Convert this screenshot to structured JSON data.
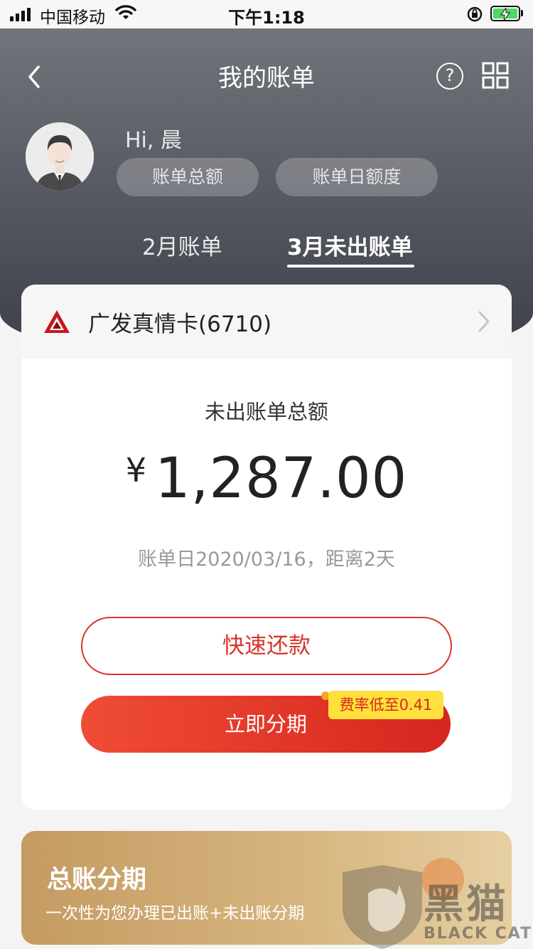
{
  "status_bar": {
    "carrier": "中国移动",
    "time": "下午1:18"
  },
  "nav": {
    "title": "我的账单",
    "help_glyph": "?"
  },
  "user": {
    "greeting": "Hi, 晨",
    "pills": [
      "账单总额",
      "账单日额度"
    ]
  },
  "tabs": [
    {
      "label": "2月账单",
      "active": false
    },
    {
      "label": "3月未出账单",
      "active": true
    }
  ],
  "card": {
    "name": "广发真情卡(6710)",
    "unbilled_label": "未出账单总额",
    "currency": "¥",
    "amount": "1,287.00",
    "bill_date_text": "账单日2020/03/16，距离2天",
    "repay_button": "快速还款",
    "installment_button": "立即分期",
    "rate_badge": "费率低至0.41"
  },
  "promo": {
    "title": "总账分期",
    "description": "一次性为您办理已出账+未出账分期"
  },
  "watermark": {
    "text": "黑猫",
    "subtext": "BLACK CAT"
  },
  "colors": {
    "accent_red": "#d9332a",
    "badge_yellow": "#ffe03c",
    "promo_gold": "#c49b62"
  }
}
